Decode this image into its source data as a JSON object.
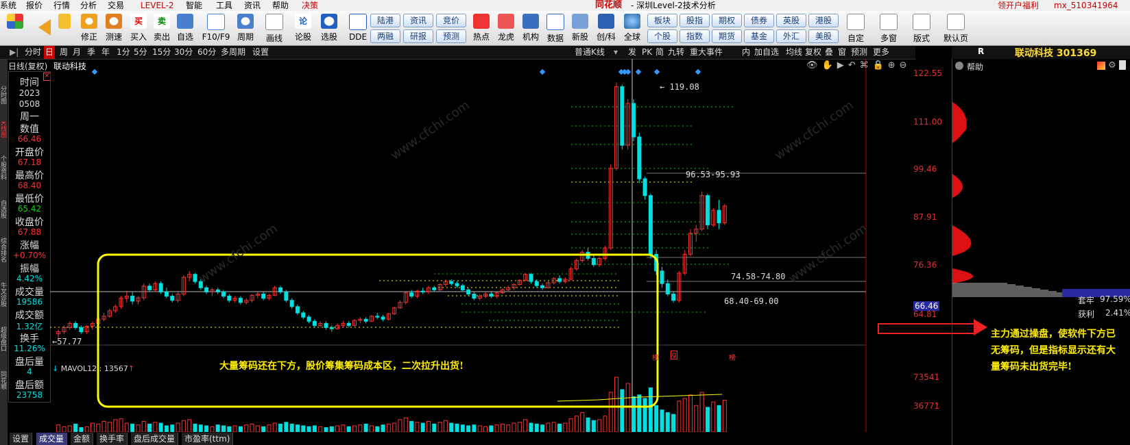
{
  "menu": [
    "系统",
    "报价",
    "行情",
    "分析",
    "交易",
    "LEVEL-2",
    "智能",
    "工具",
    "资讯",
    "帮助",
    "决策"
  ],
  "app_brand": "同花顺",
  "window_title": "- 深圳Level-2技术分析",
  "menu_right": {
    "promo": "领开户福利",
    "account": "mx_510341964"
  },
  "toolbar": {
    "buttons": [
      "修正",
      "测速",
      "买入",
      "卖出",
      "自选",
      "F10/F9",
      "周期",
      "画线",
      "论股",
      "选股",
      "DDE"
    ],
    "pills": [
      [
        "陆港",
        "资讯",
        "竞价"
      ],
      [
        "两融",
        "研报",
        "预测"
      ]
    ],
    "buttons2": [
      "热点",
      "龙虎",
      "机构",
      "数据",
      "新股",
      "创/科",
      "全球"
    ],
    "pills2": [
      [
        "板块",
        "股指",
        "期权",
        "债券",
        "英股",
        "港股"
      ],
      [
        "个股",
        "指数",
        "期货",
        "基金",
        "外汇",
        "美股"
      ]
    ],
    "buttons3": [
      "自定",
      "多窗",
      "版式",
      "默认页"
    ]
  },
  "period_bar": {
    "items": [
      "分时",
      "日",
      "周",
      "月",
      "季",
      "年",
      "1分",
      "5分",
      "15分",
      "30分",
      "60分",
      "多周期",
      "设置"
    ],
    "active": "日",
    "right": [
      "普通K线",
      "发",
      "PK",
      "简",
      "九转",
      "重大事件",
      "内",
      "加自选",
      "均线",
      "复权",
      "叠",
      "窗",
      "预测",
      "更多"
    ]
  },
  "sidebar_tabs": [
    "应用",
    "分时图",
    "K线图",
    "个股资料",
    "自选股",
    "综合排名",
    "牛叉诊股",
    "超级盘口",
    "同花顺"
  ],
  "chart_header": {
    "mode": "日线(复权)",
    "stock": "联动科技"
  },
  "info_panel": [
    {
      "label": "时间",
      "value": "2023",
      "value2": "0508",
      "value3": "周一",
      "color": "#dddddd"
    },
    {
      "label": "数值",
      "value": "66.46",
      "color": "#ff3030"
    },
    {
      "label": "开盘价",
      "value": "67.18",
      "color": "#ff3030"
    },
    {
      "label": "最高价",
      "value": "68.40",
      "color": "#ff3030"
    },
    {
      "label": "最低价",
      "value": "65.42",
      "color": "#00e000"
    },
    {
      "label": "收盘价",
      "value": "67.88",
      "color": "#ff3030"
    },
    {
      "label": "涨幅",
      "value": "+0.70%",
      "color": "#ff3030"
    },
    {
      "label": "振幅",
      "value": "4.42%",
      "color": "#00e0e0"
    },
    {
      "label": "成交量",
      "value": "19586",
      "color": "#00e0e0"
    },
    {
      "label": "成交额",
      "value": "1.32亿",
      "color": "#00e0e0"
    },
    {
      "label": "换手",
      "value": "11.26%",
      "color": "#00e0e0"
    },
    {
      "label": "盘后量",
      "value": "4",
      "color": "#00e0e0"
    },
    {
      "label": "盘后额",
      "value": "23758",
      "color": "#00e0e0"
    }
  ],
  "price_axis": [
    "122.55",
    "111.00",
    "99.46",
    "87.91",
    "76.36",
    "66.46",
    "64.81"
  ],
  "volume_axis": [
    "73541",
    "36771"
  ],
  "price_tags": {
    "high": "119.08",
    "low": "57.77",
    "band1": "96.53-95.93",
    "band2": "74.58-74.80",
    "band3": "68.40-69.00"
  },
  "markers": [
    "榜",
    "g",
    "榜"
  ],
  "volume_label": "MAVOL12 : 13567",
  "annotation_box": "大量筹码还在下方，股价筹集筹码成本区，二次拉升出货!",
  "bottom_tabs": [
    "设置",
    "成交量",
    "金额",
    "换手率",
    "盘后成交量",
    "市盈率(ttm)"
  ],
  "bottom_active": "成交量",
  "right_panel": {
    "title_prefix": "R",
    "stock_title": "联动科技 301369",
    "help": "帮助",
    "stat1_label": "套牢",
    "stat1_value": "97.59%",
    "stat2_label": "获利",
    "stat2_value": "2.41%",
    "note": "主力通过操盘，使软件下方已无筹码，但是指标显示还有大量筹码未出货完毕!"
  },
  "watermark": "www.cfchi.com",
  "colors": {
    "up": "#ff3030",
    "down": "#00e0e0",
    "box": "#ffff00",
    "chip": "#ffee00"
  },
  "chart_data": {
    "type": "candlestick",
    "ylim": [
      57,
      124
    ],
    "candles": [
      [
        60,
        61,
        59,
        60.5
      ],
      [
        60.5,
        62,
        60,
        61.5
      ],
      [
        61.5,
        63,
        61,
        62.5
      ],
      [
        62.5,
        63,
        61,
        61.5
      ],
      [
        61.5,
        62,
        60,
        60.5
      ],
      [
        60.5,
        62,
        60,
        61.8
      ],
      [
        61.8,
        63,
        61,
        62.5
      ],
      [
        62.5,
        64,
        62,
        63.5
      ],
      [
        63.5,
        65,
        63,
        64.2
      ],
      [
        64.2,
        66,
        63.8,
        65.5
      ],
      [
        65.5,
        67,
        65,
        66.5
      ],
      [
        66.5,
        69,
        66,
        68.5
      ],
      [
        68.5,
        70,
        67.5,
        69
      ],
      [
        69,
        70,
        67,
        67.8
      ],
      [
        67.8,
        69,
        67,
        68.6
      ],
      [
        68.6,
        72,
        68,
        71.4
      ],
      [
        71.4,
        72,
        70,
        70.5
      ],
      [
        70.5,
        72.5,
        70,
        72
      ],
      [
        72,
        72.5,
        69.5,
        70
      ],
      [
        70,
        71,
        68.5,
        69
      ],
      [
        69,
        69.5,
        67.5,
        68
      ],
      [
        68,
        70,
        67.5,
        69.5
      ],
      [
        69.5,
        74,
        69,
        73.5
      ],
      [
        73.5,
        75,
        72.5,
        74.2
      ],
      [
        74.2,
        74.5,
        72,
        72.5
      ],
      [
        72.5,
        73,
        70.5,
        71
      ],
      [
        71,
        71.5,
        69.5,
        70
      ],
      [
        70,
        71,
        69,
        70.5
      ],
      [
        70.5,
        71,
        69.5,
        70
      ],
      [
        70,
        70.5,
        68.5,
        69
      ],
      [
        69,
        69.5,
        67.5,
        68
      ],
      [
        68,
        69,
        67.5,
        68.5
      ],
      [
        68.5,
        69,
        67,
        67.5
      ],
      [
        67.5,
        68.5,
        67,
        68
      ],
      [
        68,
        69.5,
        67.5,
        69.2
      ],
      [
        69.2,
        70,
        68.5,
        69.5
      ],
      [
        69.5,
        70,
        68,
        68.5
      ],
      [
        68.5,
        69.5,
        68,
        69.2
      ],
      [
        69.2,
        71.5,
        69,
        71
      ],
      [
        71,
        71.5,
        69.5,
        70
      ],
      [
        70,
        70.5,
        67.5,
        68
      ],
      [
        68,
        68.5,
        66,
        66.5
      ],
      [
        66.5,
        67,
        64.5,
        65
      ],
      [
        65,
        65.5,
        63.5,
        64
      ],
      [
        64,
        64.5,
        62.5,
        63
      ],
      [
        63,
        63.5,
        61.5,
        62
      ],
      [
        62,
        63,
        61.5,
        62.5
      ],
      [
        62.5,
        63,
        61,
        61.5
      ],
      [
        61.5,
        62,
        60.5,
        61.2
      ],
      [
        61.2,
        62.5,
        61,
        62
      ],
      [
        62,
        63,
        61.5,
        62.5
      ],
      [
        62.5,
        63,
        61.5,
        62
      ],
      [
        62,
        63.5,
        61.8,
        63.2
      ],
      [
        63.2,
        64,
        62.5,
        63.5
      ],
      [
        63.5,
        64,
        62.5,
        63
      ],
      [
        63,
        64.5,
        62.8,
        64.2
      ],
      [
        64.2,
        65,
        63.5,
        64
      ],
      [
        64,
        64.5,
        63,
        63.5
      ],
      [
        63.5,
        65,
        63.2,
        64.8
      ],
      [
        64.8,
        66.5,
        64.5,
        66.2
      ],
      [
        66.2,
        68,
        66,
        67.5
      ],
      [
        67.5,
        70,
        67,
        69.8
      ],
      [
        69.8,
        70.5,
        68.5,
        69
      ],
      [
        69,
        70.5,
        68.5,
        70.2
      ],
      [
        70.2,
        71,
        69.5,
        70
      ],
      [
        70,
        71.5,
        69.5,
        71
      ],
      [
        71,
        71.5,
        70,
        70.5
      ],
      [
        70.5,
        72,
        70,
        71.8
      ],
      [
        71.8,
        73,
        71.2,
        72.5
      ],
      [
        72.5,
        73,
        71.5,
        72
      ],
      [
        72,
        72.5,
        71,
        71.5
      ],
      [
        71.5,
        72,
        70,
        70.5
      ],
      [
        70.5,
        71,
        69,
        69.5
      ],
      [
        69.5,
        70,
        68,
        68.5
      ],
      [
        68.5,
        69.5,
        68,
        69
      ],
      [
        69,
        70,
        68.5,
        69.5
      ],
      [
        69.5,
        70,
        68.5,
        69
      ],
      [
        69,
        70,
        68.5,
        69.8
      ],
      [
        69.8,
        71,
        69.5,
        70.5
      ],
      [
        70.5,
        71.5,
        70,
        71
      ],
      [
        71,
        72,
        70.5,
        71.8
      ],
      [
        71.8,
        73,
        71.5,
        72.8
      ],
      [
        72.8,
        74.5,
        72.5,
        74.2
      ],
      [
        74.2,
        74.5,
        72,
        72.5
      ],
      [
        72.5,
        73,
        71,
        71.5
      ],
      [
        71.5,
        72,
        70.5,
        71
      ],
      [
        71,
        72.5,
        70.8,
        72.2
      ],
      [
        72.2,
        73.5,
        71.8,
        73.2
      ],
      [
        73.2,
        74,
        72,
        72.5
      ],
      [
        72.5,
        73.5,
        72,
        73
      ],
      [
        73,
        76,
        72.8,
        75.5
      ],
      [
        75.5,
        78,
        75,
        77.5
      ],
      [
        77.5,
        80,
        77,
        79.5
      ],
      [
        79.5,
        80.5,
        77.5,
        78
      ],
      [
        78,
        79,
        76,
        76.5
      ],
      [
        76.5,
        78.5,
        76,
        78
      ],
      [
        78,
        81,
        77.5,
        80.5
      ],
      [
        80.5,
        100.5,
        80,
        99.5
      ],
      [
        99.5,
        120,
        99,
        119
      ],
      [
        119,
        119.5,
        104,
        105
      ],
      [
        105,
        116,
        104,
        115
      ],
      [
        115,
        116,
        106,
        107
      ],
      [
        107,
        108,
        96,
        97
      ],
      [
        97,
        97.5,
        92,
        93
      ],
      [
        93,
        93.5,
        78,
        79
      ],
      [
        79,
        80,
        74,
        75
      ],
      [
        75,
        76,
        71,
        72
      ],
      [
        72,
        73,
        69,
        69.5
      ],
      [
        69.5,
        70,
        67.5,
        68
      ],
      [
        68,
        75,
        67.5,
        74.5
      ],
      [
        74.5,
        80,
        74,
        79
      ],
      [
        79,
        85,
        78.5,
        84
      ],
      [
        84,
        86,
        82,
        85
      ],
      [
        85,
        94,
        84.5,
        93
      ],
      [
        93,
        93.5,
        85,
        86
      ],
      [
        86,
        90,
        85.5,
        89.5
      ],
      [
        89.5,
        92,
        85,
        86.5
      ],
      [
        86.5,
        91,
        86,
        90.5
      ]
    ],
    "volume": [
      8,
      6,
      7,
      9,
      5,
      6,
      10,
      9,
      12,
      11,
      14,
      15,
      10,
      9,
      8,
      12,
      9,
      11,
      10,
      7,
      8,
      10,
      13,
      14,
      9,
      8,
      7,
      6,
      8,
      7,
      6,
      7,
      6,
      8,
      9,
      7,
      6,
      8,
      10,
      9,
      11,
      9,
      8,
      7,
      6,
      7,
      6,
      5,
      6,
      7,
      8,
      6,
      7,
      8,
      9,
      7,
      6,
      8,
      9,
      10,
      14,
      16,
      12,
      11,
      10,
      12,
      9,
      11,
      13,
      10,
      9,
      8,
      7,
      8,
      7,
      6,
      7,
      8,
      9,
      8,
      10,
      11,
      14,
      10,
      9,
      8,
      10,
      11,
      9,
      10,
      15,
      18,
      22,
      16,
      13,
      14,
      18,
      45,
      62,
      48,
      55,
      40,
      42,
      38,
      50,
      30,
      25,
      22,
      20,
      35,
      38,
      42,
      30,
      45,
      28,
      34,
      30,
      36
    ]
  }
}
